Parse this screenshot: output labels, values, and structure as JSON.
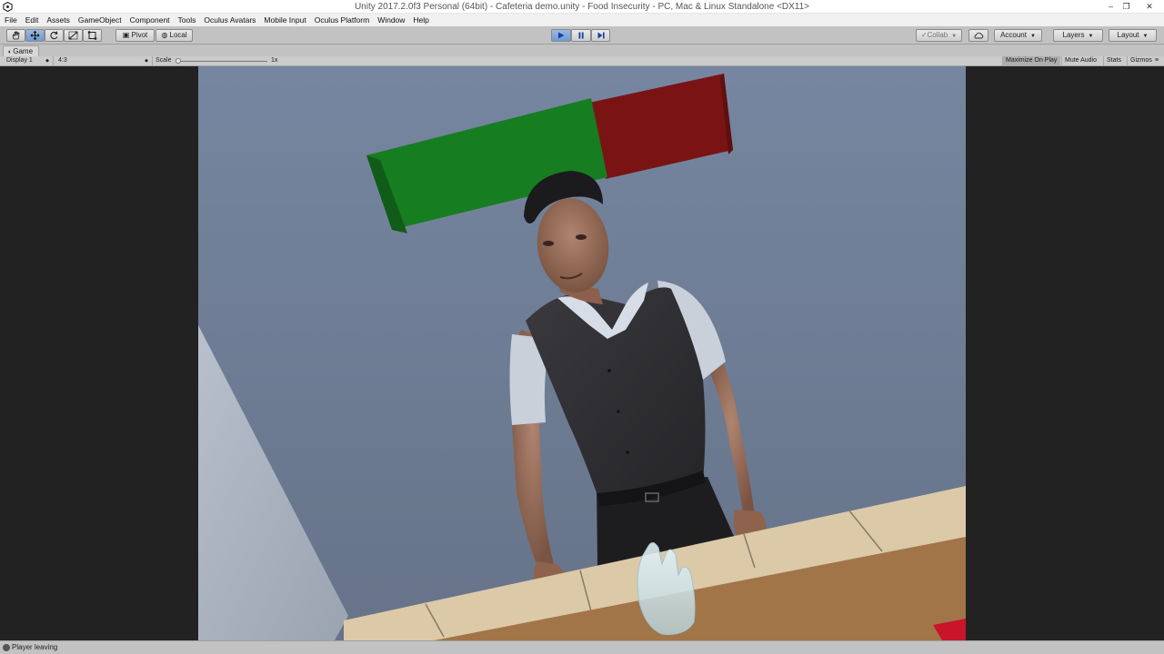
{
  "window": {
    "title": "Unity 2017.2.0f3 Personal (64bit) - Cafeteria demo.unity - Food Insecurity - PC, Mac & Linux Standalone <DX11>",
    "controls": {
      "minimize": "–",
      "restore": "❐",
      "close": "✕"
    }
  },
  "menu": [
    "File",
    "Edit",
    "Assets",
    "GameObject",
    "Component",
    "Tools",
    "Oculus Avatars",
    "Mobile Input",
    "Oculus Platform",
    "Window",
    "Help"
  ],
  "toolbar": {
    "tools": [
      "hand-icon",
      "move-icon",
      "rotate-icon",
      "scale-icon",
      "rect-icon"
    ],
    "pivot_label": "Pivot",
    "local_label": "Local",
    "play_state": "playing",
    "collab_label": "Collab",
    "account_label": "Account",
    "layers_label": "Layers",
    "layout_label": "Layout"
  },
  "game_panel": {
    "tab_label": "Game",
    "display": "Display 1",
    "aspect": "4:3",
    "scale_label": "Scale",
    "scale_value": "1x",
    "buttons": [
      "Maximize On Play",
      "Mute Audio",
      "Stats",
      "Gizmos"
    ]
  },
  "status": {
    "message": "Player leaving"
  },
  "colors": {
    "panel": "#c2c2c2",
    "play_active": "#6f9bd3",
    "sky": "#6e7c96",
    "green_block": "#157a1f",
    "red_block": "#7a1313",
    "counter": "#a27549"
  }
}
